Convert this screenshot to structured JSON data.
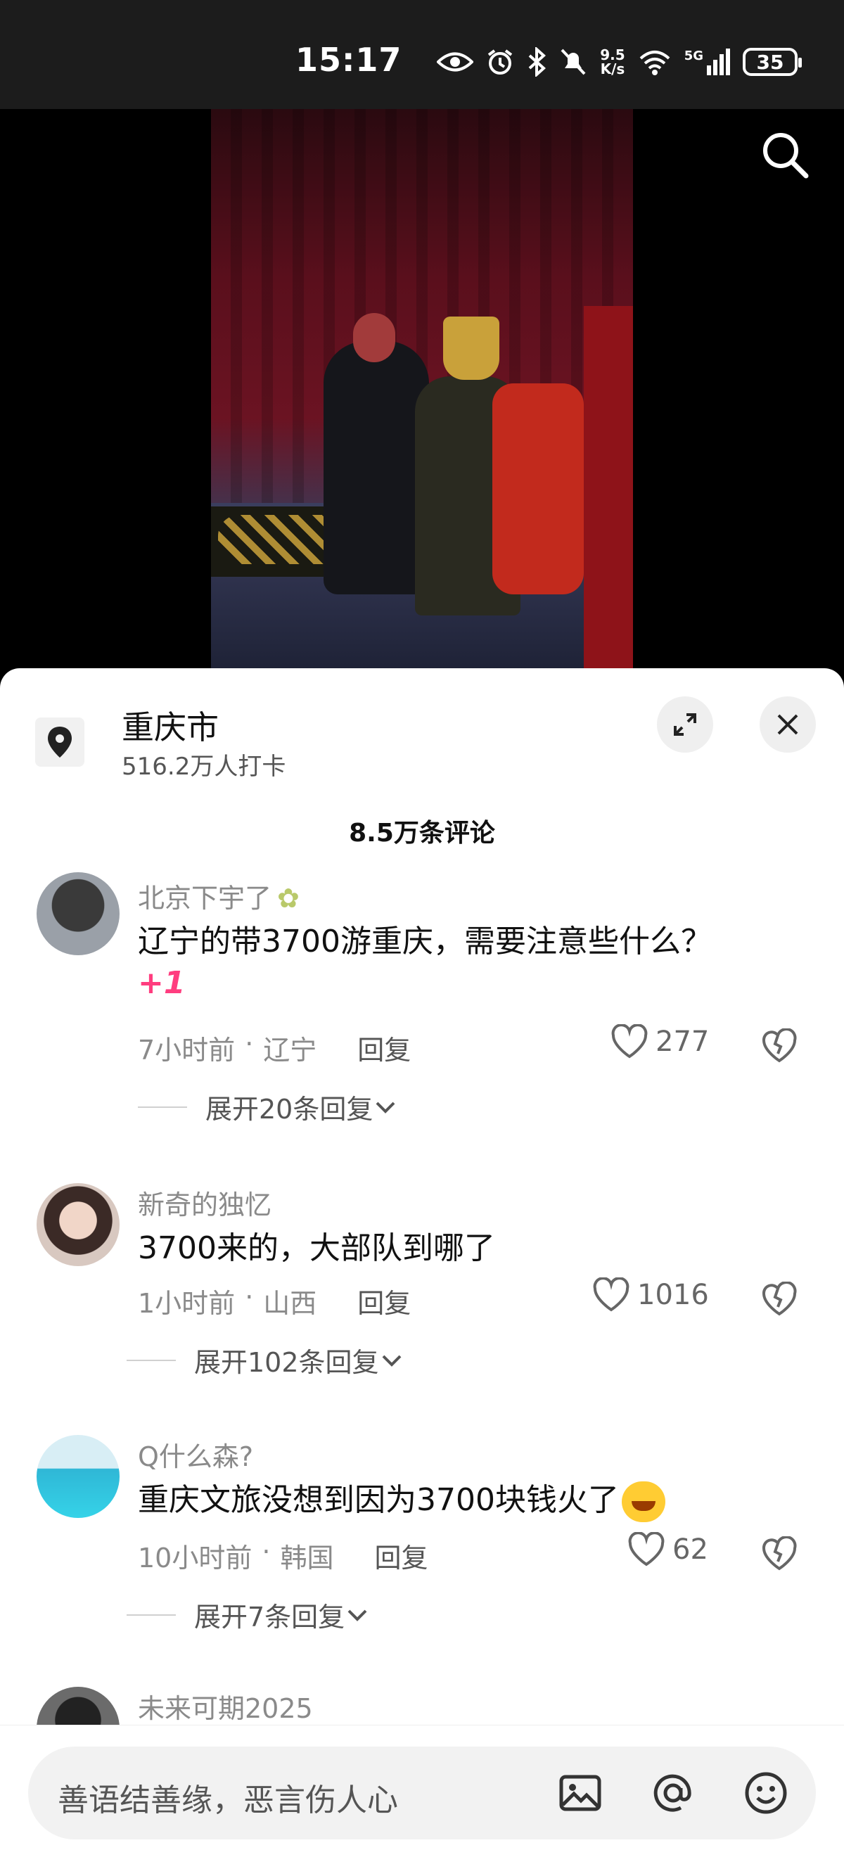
{
  "status_bar": {
    "time": "15:17",
    "net_speed_value": "9.5",
    "net_speed_unit": "K/s",
    "network": "5G",
    "battery": "35",
    "icons": [
      "eye-icon",
      "alarm-icon",
      "bluetooth-icon",
      "mute-icon",
      "wifi-icon",
      "signal-icon",
      "battery-icon"
    ]
  },
  "video": {
    "search_icon": "search-icon"
  },
  "location": {
    "name": "重庆市",
    "checkins": "516.2万人打卡",
    "icon": "location-pin-icon"
  },
  "comments_header": {
    "count": "8.5万条评论"
  },
  "comments": [
    {
      "username": "北京下宇了",
      "text": "辽宁的带3700游重庆，需要注意些什么？",
      "sticker": "+1",
      "time": "7小时前",
      "location": "辽宁",
      "reply_label": "回复",
      "likes": "277",
      "more_replies": "展开20条回复"
    },
    {
      "username": "新奇的独忆",
      "text": "3700来的，大部队到哪了",
      "time": "1小时前",
      "location": "山西",
      "reply_label": "回复",
      "likes": "1016",
      "more_replies": "展开102条回复"
    },
    {
      "username": "Q什么森?",
      "text": "重庆文旅没想到因为3700块钱火了",
      "time": "10小时前",
      "location": "韩国",
      "reply_label": "回复",
      "likes": "62",
      "more_replies": "展开7条回复"
    },
    {
      "username": "未来可期2025"
    }
  ],
  "input_bar": {
    "placeholder": "善语结善缘，恶言伤人心",
    "icons": [
      "image-icon",
      "at-icon",
      "emoji-icon"
    ]
  },
  "colors": {
    "accent_pink": "#ff3d7f",
    "meta_gray": "#8a8a8a",
    "status_bg": "#1c1c1c"
  }
}
